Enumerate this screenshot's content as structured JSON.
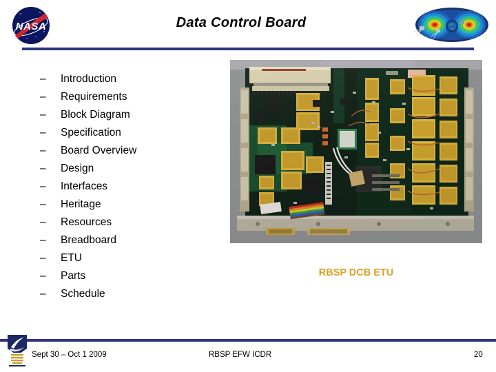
{
  "header": {
    "title": "Data Control Board",
    "nasa_logo_alt": "NASA",
    "rule_color": "#2e3480"
  },
  "outline": {
    "bullet": "–",
    "items": [
      {
        "label": "Introduction"
      },
      {
        "label": "Requirements"
      },
      {
        "label": "Block Diagram"
      },
      {
        "label": "Specification"
      },
      {
        "label": "Board Overview"
      },
      {
        "label": "Design"
      },
      {
        "label": "Interfaces"
      },
      {
        "label": "Heritage"
      },
      {
        "label": "Resources"
      },
      {
        "label": "Breadboard"
      },
      {
        "label": "ETU"
      },
      {
        "label": "Parts"
      },
      {
        "label": "Schedule"
      }
    ]
  },
  "photo": {
    "caption": "RBSP DCB ETU",
    "caption_color": "#d9a227"
  },
  "footer": {
    "date": "Sept 30 – Oct 1 2009",
    "event": "RBSP EFW ICDR",
    "page": "20"
  }
}
